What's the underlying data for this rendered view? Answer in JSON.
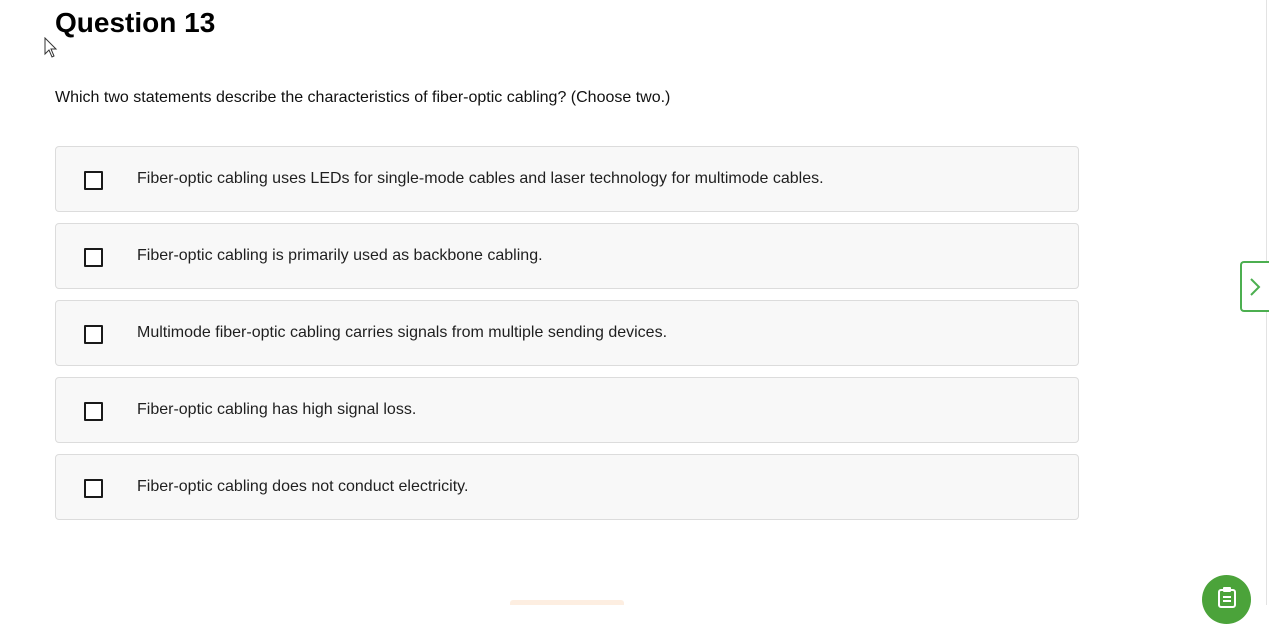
{
  "question": {
    "title": "Question 13",
    "prompt": "Which two statements describe the characteristics of fiber-optic cabling? (Choose two.)"
  },
  "options": [
    {
      "label": "Fiber-optic cabling uses LEDs for single-mode cables and laser technology for multimode cables.",
      "checked": false
    },
    {
      "label": "Fiber-optic cabling is primarily used as backbone cabling.",
      "checked": false
    },
    {
      "label": "Multimode fiber-optic cabling carries signals from multiple sending devices.",
      "checked": false
    },
    {
      "label": "Fiber-optic cabling has high signal loss.",
      "checked": false
    },
    {
      "label": "Fiber-optic cabling does not conduct electricity.",
      "checked": false
    }
  ],
  "icons": {
    "next": "chevron-right-icon",
    "fab": "clipboard-icon",
    "cursor": "mouse-pointer-icon"
  },
  "colors": {
    "accent": "#4caf50",
    "fab": "#4ba33a",
    "option_background": "#f8f8f8",
    "option_border": "#dcdcdc"
  }
}
